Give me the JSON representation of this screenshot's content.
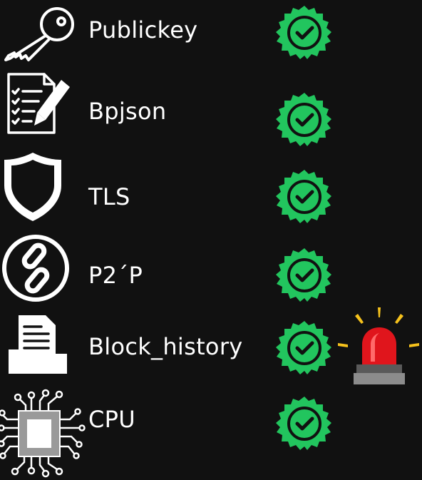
{
  "colors": {
    "background": "#111111",
    "check_badge": "#22c55e",
    "alarm_red": "#e0151c",
    "alarm_rays": "#f6c21c"
  },
  "items": [
    {
      "label": "Publickey",
      "icon": "key-icon",
      "status": "ok"
    },
    {
      "label": "Bpjson",
      "icon": "checklist-document-icon",
      "status": "ok"
    },
    {
      "label": "TLS",
      "icon": "shield-icon",
      "status": "ok"
    },
    {
      "label": "P2´P",
      "icon": "link-icon",
      "status": "ok"
    },
    {
      "label": "Block_history",
      "icon": "folder-document-icon",
      "status": "ok",
      "alert": "siren-alarm-icon"
    },
    {
      "label": "CPU",
      "icon": "cpu-chip-icon",
      "status": "ok"
    }
  ]
}
